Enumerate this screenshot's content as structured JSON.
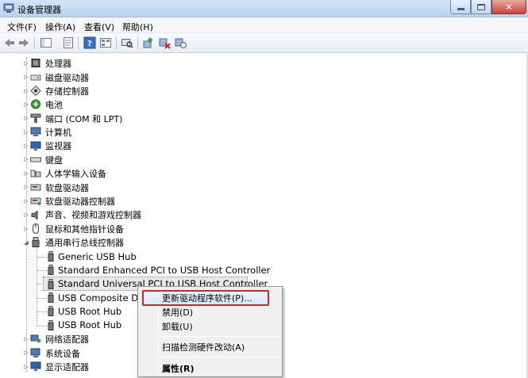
{
  "window": {
    "title": "设备管理器"
  },
  "menubar": {
    "items": [
      "文件(F)",
      "操作(A)",
      "查看(V)",
      "帮助(H)"
    ]
  },
  "toolbar": {
    "icons": [
      "back-arrow-icon",
      "forward-arrow-icon",
      "show-hide-tree-icon",
      "properties-icon",
      "help-icon",
      "view-icon",
      "scan-hardware-icon",
      "update-driver-icon",
      "disable-device-icon",
      "uninstall-device-icon"
    ]
  },
  "tree": {
    "categories": [
      {
        "label": "处理器",
        "icon": "processor-icon"
      },
      {
        "label": "磁盘驱动器",
        "icon": "disk-drive-icon"
      },
      {
        "label": "存储控制器",
        "icon": "storage-controller-icon"
      },
      {
        "label": "电池",
        "icon": "battery-icon"
      },
      {
        "label": "端口 (COM 和 LPT)",
        "icon": "port-icon"
      },
      {
        "label": "计算机",
        "icon": "computer-icon"
      },
      {
        "label": "监视器",
        "icon": "monitor-icon"
      },
      {
        "label": "键盘",
        "icon": "keyboard-icon"
      },
      {
        "label": "人体学输入设备",
        "icon": "hid-icon"
      },
      {
        "label": "软盘驱动器",
        "icon": "floppy-drive-icon"
      },
      {
        "label": "软盘驱动器控制器",
        "icon": "floppy-controller-icon"
      },
      {
        "label": "声音、视频和游戏控制器",
        "icon": "sound-icon"
      },
      {
        "label": "鼠标和其他指针设备",
        "icon": "mouse-icon"
      },
      {
        "label": "通用串行总线控制器",
        "icon": "usb-icon",
        "expanded": true
      }
    ],
    "usb_children": [
      {
        "label": "Generic USB Hub"
      },
      {
        "label": "Standard Enhanced PCI to USB Host Controller"
      },
      {
        "label": "Standard Universal PCI to USB Host Controller",
        "selected": true
      },
      {
        "label": "USB Composite Dev"
      },
      {
        "label": "USB Root Hub"
      },
      {
        "label": "USB Root Hub"
      }
    ],
    "after_categories": [
      {
        "label": "网络适配器",
        "icon": "network-adapter-icon"
      },
      {
        "label": "系统设备",
        "icon": "system-device-icon"
      },
      {
        "label": "显示适配器",
        "icon": "display-adapter-icon"
      }
    ]
  },
  "context_menu": {
    "update_driver": "更新驱动程序软件(P)...",
    "disable": "禁用(D)",
    "uninstall": "卸载(U)",
    "scan": "扫描检测硬件改动(A)",
    "properties": "属性(R)"
  },
  "colors": {
    "highlight_border": "#d0252b",
    "title_bar": "#c6daf3"
  }
}
